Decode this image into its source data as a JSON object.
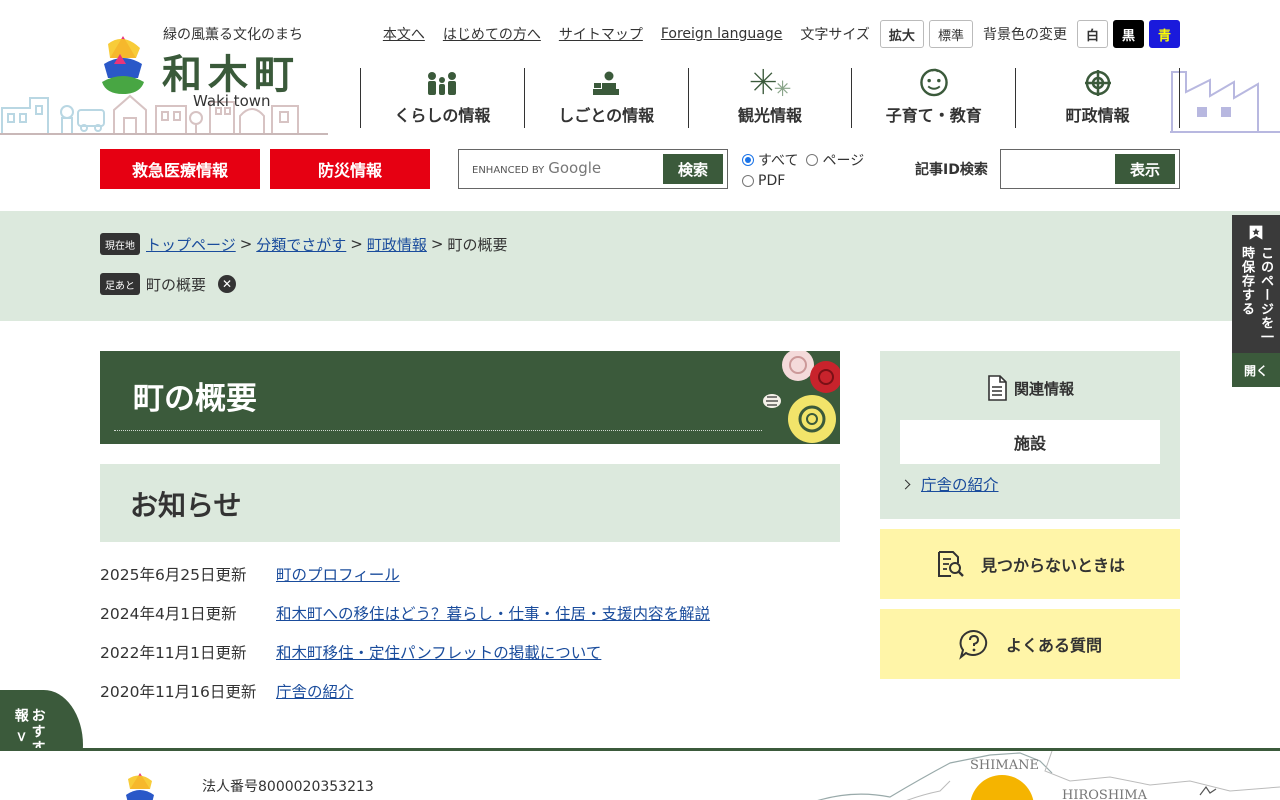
{
  "header": {
    "logo": {
      "tagline": "緑の風薫る文化のまち",
      "name": "和木町",
      "roman": "Waki town"
    },
    "util_links": [
      "本文へ",
      "はじめての方へ",
      "サイトマップ",
      "Foreign language"
    ],
    "font_size": {
      "label": "文字サイズ",
      "enlarge": "拡大",
      "standard": "標準"
    },
    "bg_color": {
      "label": "背景色の変更",
      "white": "白",
      "black": "黒",
      "blue": "青"
    },
    "global_nav": [
      {
        "label": "くらしの情報",
        "icon": "people-icon"
      },
      {
        "label": "しごとの情報",
        "icon": "worker-icon"
      },
      {
        "label": "観光情報",
        "icon": "fireworks-icon"
      },
      {
        "label": "子育て・教育",
        "icon": "child-face-icon"
      },
      {
        "label": "町政情報",
        "icon": "town-emblem-icon"
      }
    ]
  },
  "quick": {
    "emergency": "救急医療情報",
    "disaster": "防災情報"
  },
  "search": {
    "google_label": "ENHANCED BY",
    "google_brand": "Google",
    "button": "検索",
    "scopes": [
      "すべて",
      "ページ",
      "PDF"
    ],
    "selected_scope": "すべて"
  },
  "article_search": {
    "label": "記事ID検索",
    "button": "表示"
  },
  "breadcrumb": {
    "current_tag": "現在地",
    "items": [
      "トップページ",
      "分類でさがす",
      "町政情報"
    ],
    "current": "町の概要",
    "history_tag": "足あと",
    "history_item": "町の概要"
  },
  "bookmark": {
    "text": "このページを一時保存する",
    "open": "開く"
  },
  "page": {
    "title": "町の概要",
    "section": "お知らせ"
  },
  "news": [
    {
      "date": "2025年6月25日更新",
      "title": "町のプロフィール"
    },
    {
      "date": "2024年4月1日更新",
      "title": "和木町への移住はどう？暮らし・仕事・住居・支援内容を解説"
    },
    {
      "date": "2022年11月1日更新",
      "title": "和木町移住・定住パンフレットの掲載について"
    },
    {
      "date": "2020年11月16日更新",
      "title": "庁舎の紹介"
    }
  ],
  "sidebar": {
    "related_title": "関連情報",
    "related_sub": "施設",
    "related_link": "庁舎の紹介",
    "not_found": "見つからないときは",
    "faq": "よくある質問"
  },
  "recommend": "おすすめ情報 >",
  "footer": {
    "corp_number": "法人番号8000020353213",
    "map_labels": {
      "shimane": "SHIMANE",
      "hiroshima": "HIROSHIMA"
    }
  },
  "colors": {
    "green": "#3b5a3b",
    "light_green": "#dce9dd",
    "red": "#e60012",
    "yellow": "#fff5a8",
    "link": "#1a4c9c"
  }
}
